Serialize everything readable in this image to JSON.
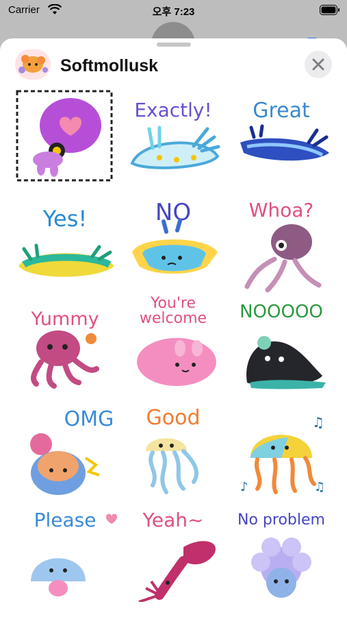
{
  "status": {
    "carrier": "Carrier",
    "time": "오후 7:23"
  },
  "header": {
    "title": "Softmollusk",
    "close_icon": "close-icon"
  },
  "stickers": [
    {
      "label": "",
      "color": "#b64fd8"
    },
    {
      "label": "Exactly!",
      "color": "#6b4fd0"
    },
    {
      "label": "Great",
      "color": "#3b89cf"
    },
    {
      "label": "Yes!",
      "color": "#2a8bd4"
    },
    {
      "label": "NO",
      "color": "#4646c0"
    },
    {
      "label": "Whoa?",
      "color": "#e0507e"
    },
    {
      "label": "Yummy",
      "color": "#e0507e"
    },
    {
      "label": "You're\nwelcome",
      "color": "#e0507e"
    },
    {
      "label": "NOOOOO",
      "color": "#2b9a3f"
    },
    {
      "label": "OMG",
      "color": "#3b8bd8"
    },
    {
      "label": "Good",
      "color": "#f07b30"
    },
    {
      "label": "",
      "color": "#333"
    },
    {
      "label": "Please",
      "color": "#3b8bd8"
    },
    {
      "label": "Yeah~",
      "color": "#e0507e"
    },
    {
      "label": "No problem",
      "color": "#4646c0"
    }
  ]
}
